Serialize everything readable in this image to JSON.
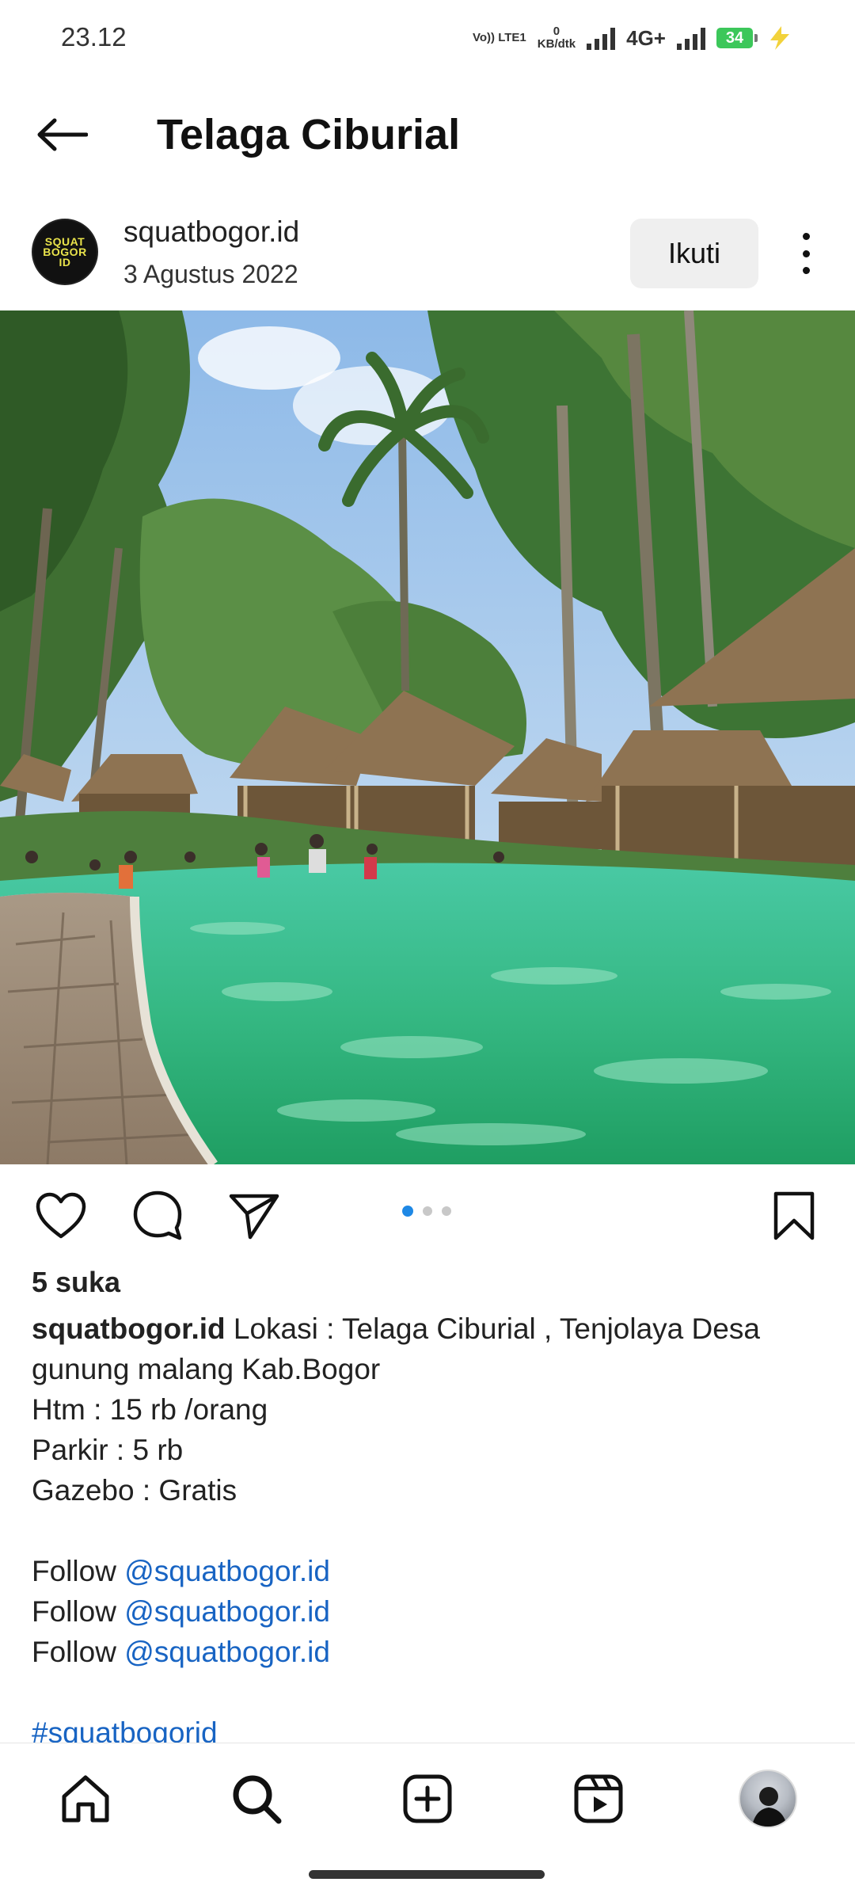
{
  "status_bar": {
    "time": "23.12",
    "volte": "Vo)) LTE1",
    "speed_value": "0",
    "speed_unit": "KB/dtk",
    "network": "4G+",
    "battery": "34"
  },
  "header": {
    "title": "Telaga Ciburial"
  },
  "post": {
    "username": "squatbogor.id",
    "date": "3 Agustus 2022",
    "follow_label": "Ikuti",
    "avatar_text": "SQUAT BOGOR ID",
    "carousel": {
      "count": 3,
      "active": 1
    },
    "likes": "5 suka",
    "caption": {
      "username": "squatbogor.id",
      "line1": " Lokasi : Telaga Ciburial , Tenjolaya Desa gunung malang Kab.Bogor",
      "line2": "Htm : 15 rb /orang",
      "line3": "Parkir : 5 rb",
      "line4": "Gazebo : Gratis",
      "follow_prefix": "Follow ",
      "follow_mention": "@squatbogor.id",
      "hashtag": "#squatbogorid"
    }
  },
  "colors": {
    "link": "#1864c3",
    "active_dot": "#1e88e5",
    "battery": "#3cc75a"
  },
  "icons": [
    "back-arrow-icon",
    "more-vert-icon",
    "heart-icon",
    "comment-icon",
    "send-icon",
    "bookmark-icon",
    "home-icon",
    "search-icon",
    "add-icon",
    "reels-icon"
  ]
}
